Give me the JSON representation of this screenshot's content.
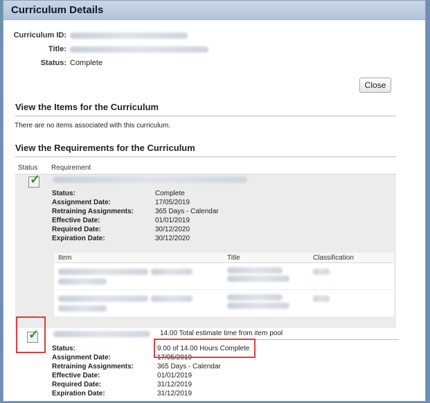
{
  "dialog": {
    "title": "Curriculum Details"
  },
  "fields": {
    "curriculum_id_label": "Curriculum ID:",
    "title_label": "Title:",
    "status_label": "Status:",
    "status_value": "Complete"
  },
  "buttons": {
    "close": "Close"
  },
  "items_section": {
    "title": "View the Items for the Curriculum",
    "empty_message": "There are no items associated with this curriculum."
  },
  "requirements_section": {
    "title": "View the Requirements for the Curriculum",
    "col_status": "Status",
    "col_requirement": "Requirement"
  },
  "requirement1": {
    "labels": [
      "Status:",
      "Assignment Date:",
      "Retraining Assignments:",
      "Effective Date:",
      "Required Date:",
      "Expiration Date:"
    ],
    "values": [
      "Complete",
      "17/05/2019",
      "365 Days - Calendar",
      "01/01/2019",
      "30/12/2020",
      "30/12/2020"
    ],
    "table_headers": {
      "item": "Item",
      "title": "Title",
      "classification": "Classification"
    }
  },
  "requirement2": {
    "pool_text": "14.00 Total estimate time from item pool",
    "labels": [
      "Status:",
      "Assignment Date:",
      "Retraining Assignments:",
      "Effective Date:",
      "Required Date:",
      "Expiration Date:"
    ],
    "values": [
      "9.00 of 14.00 Hours Complete",
      "17/05/2019",
      "365 Days - Calendar",
      "01/01/2019",
      "31/12/2019",
      "31/12/2019"
    ]
  },
  "colors": {
    "highlight": "#e23b3b",
    "check": "#1f9a1f",
    "titlebar": "#b3c4da"
  },
  "icons": {
    "check": "checkmark-icon"
  }
}
